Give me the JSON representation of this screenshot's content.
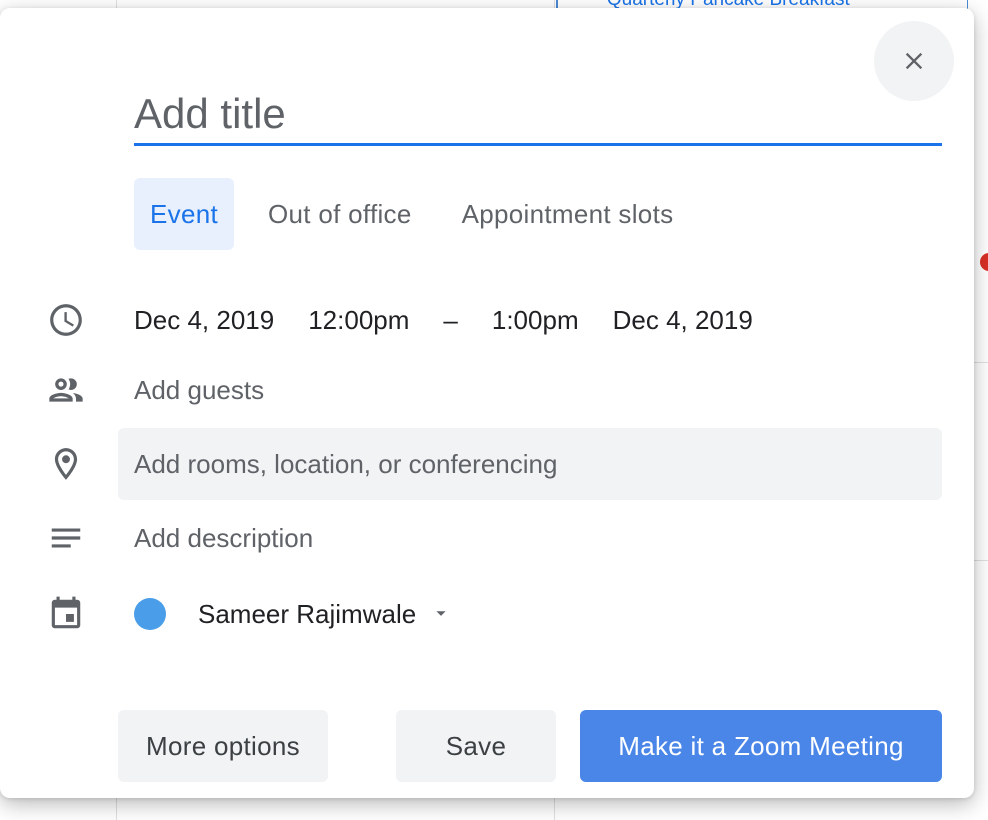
{
  "background": {
    "event_label": "**** Quarterly Pancake Breakfast ****"
  },
  "dialog": {
    "title_placeholder": "Add title",
    "tabs": [
      {
        "label": "Event",
        "active": true
      },
      {
        "label": "Out of office",
        "active": false
      },
      {
        "label": "Appointment slots",
        "active": false
      }
    ],
    "datetime": {
      "start_date": "Dec 4, 2019",
      "start_time": "12:00pm",
      "separator": "–",
      "end_time": "1:00pm",
      "end_date": "Dec 4, 2019"
    },
    "guests_placeholder": "Add guests",
    "location_placeholder": "Add rooms, location, or conferencing",
    "description_placeholder": "Add description",
    "calendar": {
      "name": "Sameer Rajimwale",
      "color": "#4a9de8"
    },
    "buttons": {
      "more_options": "More options",
      "save": "Save",
      "zoom": "Make it a Zoom Meeting"
    },
    "icons": {
      "close": "close-icon",
      "time": "clock-icon",
      "guests": "people-icon",
      "location": "location-pin-icon",
      "description": "notes-icon",
      "calendar": "calendar-icon",
      "dropdown": "caret-down-icon"
    }
  }
}
